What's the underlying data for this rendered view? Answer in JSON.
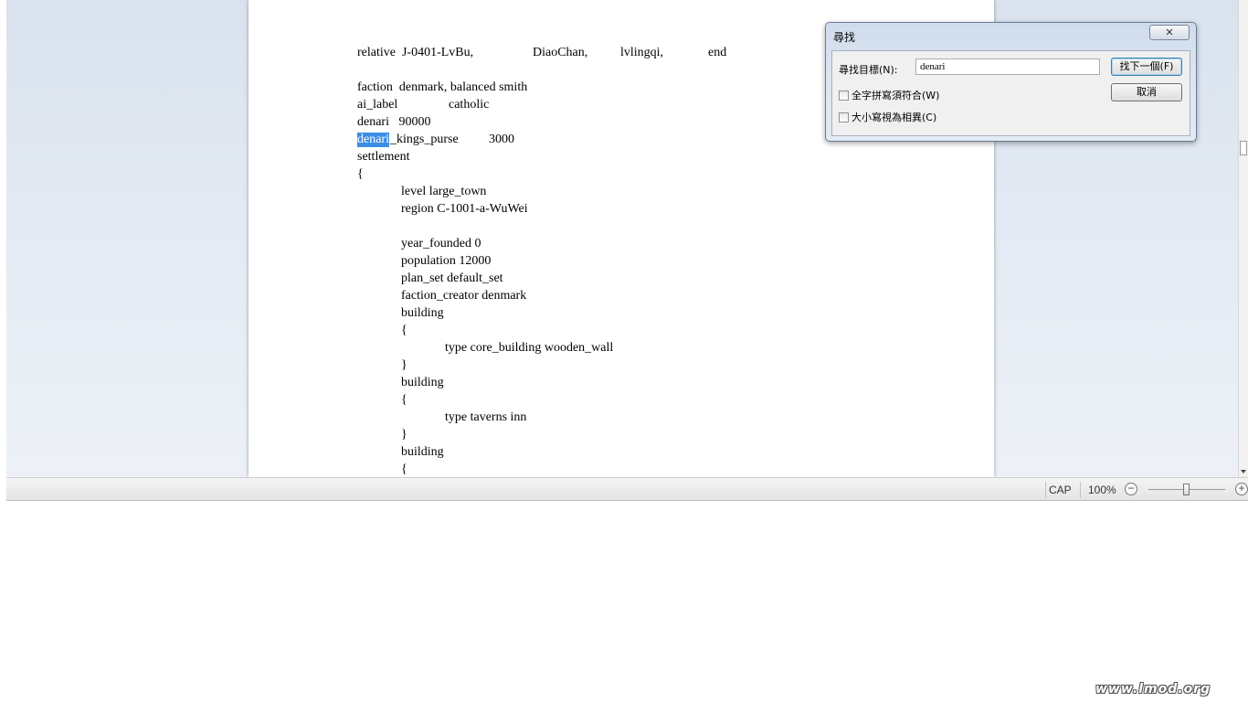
{
  "document": {
    "lines": {
      "l0a": "relative  J-0401-LvBu,",
      "l0b": "DiaoChan,",
      "l0c": "lvlingqi,",
      "l0d": "end",
      "l1": "faction  denmark, balanced smith",
      "l2a": "ai_label",
      "l2b": "catholic",
      "l3": "denari   90000",
      "l4_hl": "denari",
      "l4a": "_kings_purse",
      "l4b": "3000",
      "l5": "settlement",
      "l6": "{",
      "l7": "level large_town",
      "l8": "region C-1001-a-WuWei",
      "l9": "year_founded 0",
      "l10": "population 12000",
      "l11": "plan_set default_set",
      "l12": "faction_creator denmark",
      "l13": "building",
      "l14": "{",
      "l15": "type core_building wooden_wall",
      "l16": "}",
      "l17": "building",
      "l18": "{",
      "l19": "type taverns inn",
      "l20": "}",
      "l21": "building",
      "l22": "{"
    }
  },
  "find_dialog": {
    "title": "尋找",
    "close": "✕",
    "find_label": "尋找目標(N):",
    "find_value": "denari",
    "find_next": "找下一個(F)",
    "cancel": "取消",
    "whole_word": "全字拼寫須符合(W)",
    "match_case": "大小寫視為相異(C)"
  },
  "statusbar": {
    "caps": "CAP",
    "zoom": "100%",
    "zoom_out": "−",
    "zoom_in": "+",
    "zoom_level_percent": 100
  },
  "watermark": "www.lmod.org",
  "colors": {
    "selection": "#3c8ee5",
    "workspace_bg": "#dfe7f1"
  }
}
